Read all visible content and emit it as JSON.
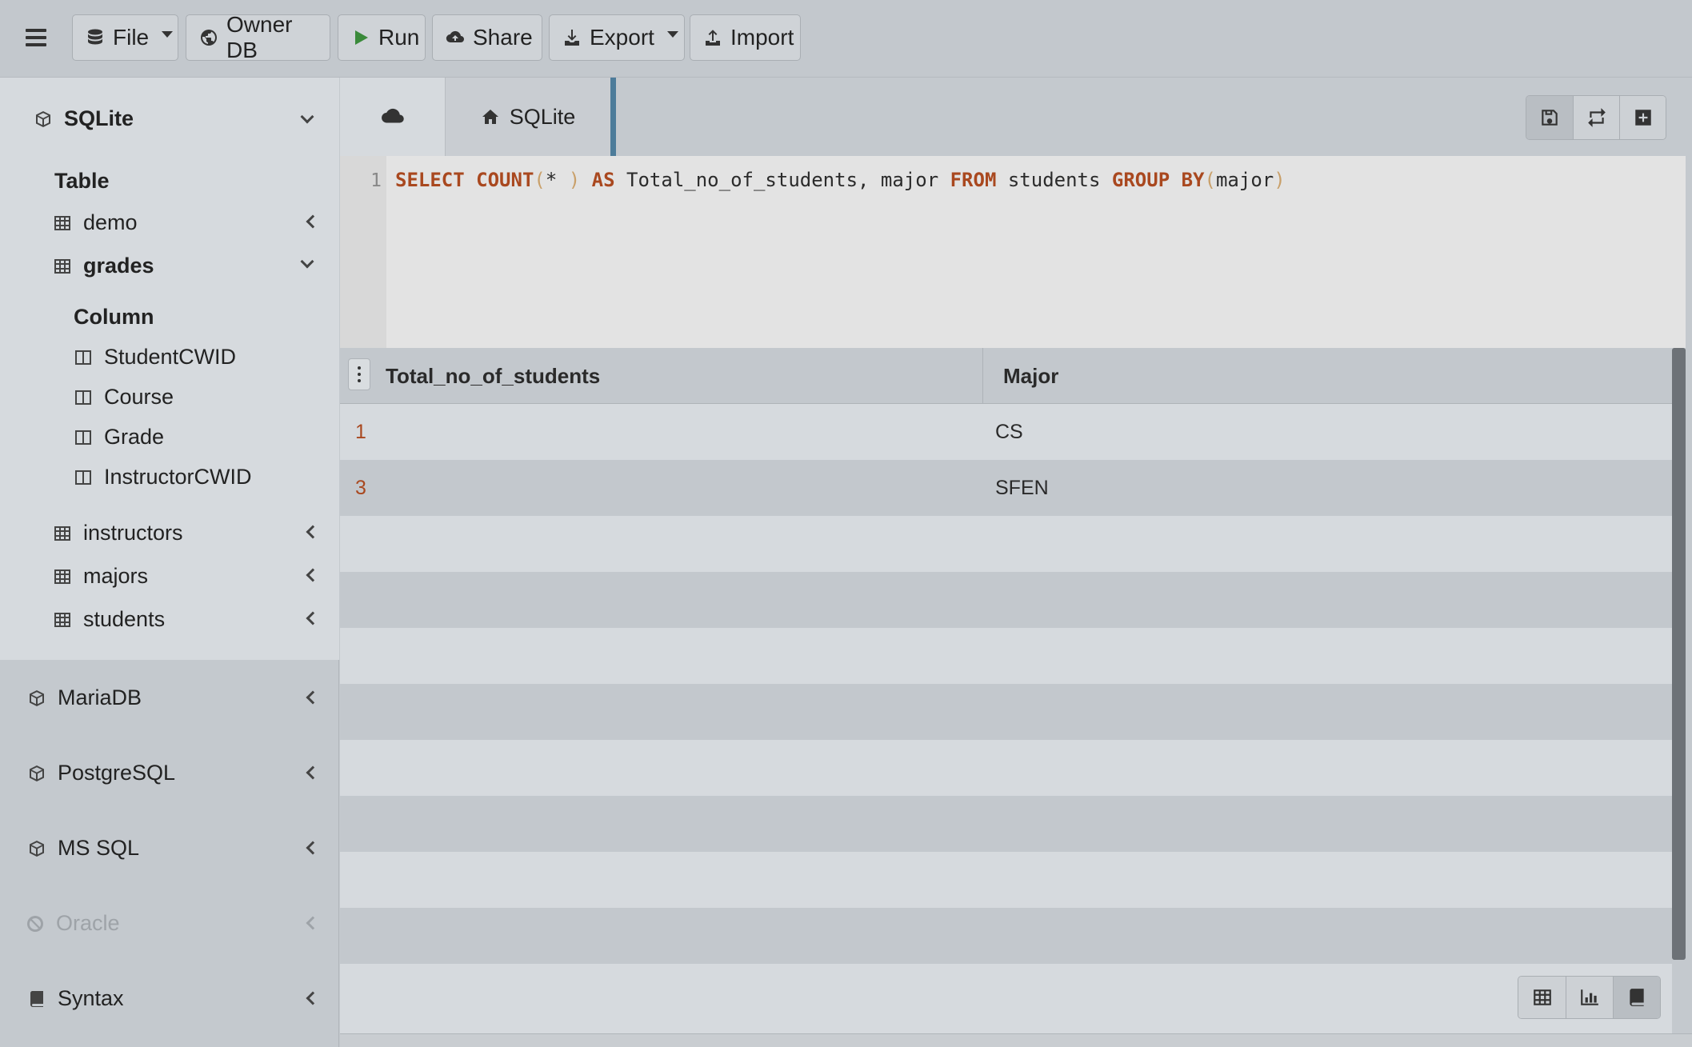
{
  "toolbar": {
    "file_label": "File",
    "ownerdb_label": "Owner DB",
    "run_label": "Run",
    "share_label": "Share",
    "export_label": "Export",
    "import_label": "Import"
  },
  "sidebar": {
    "active_db": "SQLite",
    "table_heading": "Table",
    "tables": [
      {
        "name": "demo",
        "expanded": false
      },
      {
        "name": "grades",
        "expanded": true
      },
      {
        "name": "instructors",
        "expanded": false
      },
      {
        "name": "majors",
        "expanded": false
      },
      {
        "name": "students",
        "expanded": false
      }
    ],
    "column_heading": "Column",
    "columns": [
      "StudentCWID",
      "Course",
      "Grade",
      "InstructorCWID"
    ],
    "databases": [
      {
        "name": "MariaDB",
        "icon": "cube-icon",
        "enabled": true
      },
      {
        "name": "PostgreSQL",
        "icon": "cube-icon",
        "enabled": true
      },
      {
        "name": "MS SQL",
        "icon": "cube-icon",
        "enabled": true
      },
      {
        "name": "Oracle",
        "icon": "ban-icon",
        "enabled": false
      },
      {
        "name": "Syntax",
        "icon": "book-icon",
        "enabled": true
      }
    ]
  },
  "tabs": {
    "active_tab": "SQLite"
  },
  "editor": {
    "line_number": "1",
    "tokens": {
      "t1": "SELECT",
      "t2": " ",
      "t3": "COUNT",
      "t4": "(",
      "t5": "* ",
      "t6": ")",
      "t7": " ",
      "t8": "AS",
      "t9": " Total_no_of_students, major ",
      "t10": "FROM",
      "t11": " students ",
      "t12": "GROUP",
      "t13": " ",
      "t14": "BY",
      "t15": "(",
      "t16": "major",
      "t17": ")"
    }
  },
  "results": {
    "columns": [
      "Total_no_of_students",
      "Major"
    ],
    "rows": [
      {
        "count": "1",
        "major": "CS"
      },
      {
        "count": "3",
        "major": "SFEN"
      }
    ]
  },
  "colors": {
    "keyword": "#a9481f",
    "accent": "#4d7c9a",
    "run_icon": "#3a8a3a"
  }
}
